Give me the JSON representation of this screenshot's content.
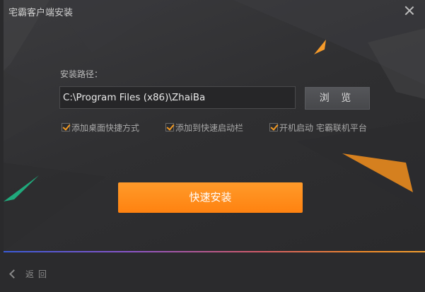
{
  "window": {
    "title": "宅霸客户端安装"
  },
  "install": {
    "path_label": "安装路径：",
    "path_value": "C:\\Program Files (x86)\\ZhaiBa",
    "browse_label": "浏 览",
    "options": [
      {
        "label": "添加桌面快捷方式",
        "checked": true
      },
      {
        "label": "添加到快速启动栏",
        "checked": true
      },
      {
        "label": "开机启动 宅霸联机平台",
        "checked": true
      }
    ],
    "install_button": "快速安装"
  },
  "footer": {
    "back_label": "返回",
    "back_icon": "chevron-left-icon"
  },
  "colors": {
    "accent": "#ff8a1a",
    "background": "#333335",
    "check": "#f39a22"
  }
}
